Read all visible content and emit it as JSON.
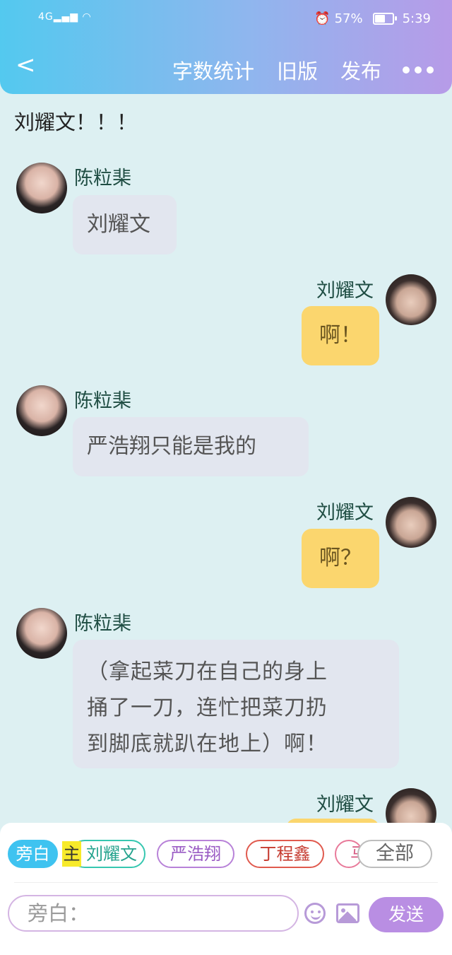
{
  "status_bar": {
    "signal": "4G",
    "battery": "57%",
    "time": "5:39"
  },
  "header": {
    "back": "<",
    "word_count": "字数统计",
    "old_version": "旧版",
    "publish": "发布"
  },
  "note": "刘耀文！！！",
  "messages": [
    {
      "side": "left",
      "name": "陈粒棐",
      "lines": [
        "刘耀文"
      ]
    },
    {
      "side": "right",
      "name": "刘耀文",
      "lines": [
        "啊！"
      ]
    },
    {
      "side": "left",
      "name": "陈粒棐",
      "lines": [
        "严浩翔只能是我的"
      ]
    },
    {
      "side": "right",
      "name": "刘耀文",
      "lines": [
        "啊？"
      ]
    },
    {
      "side": "left",
      "name": "陈粒棐",
      "lines": [
        "（拿起菜刀在自己的身上",
        "捅了一刀，连忙把菜刀扔",
        "到脚底就趴在地上）啊！"
      ]
    },
    {
      "side": "right",
      "name": "刘耀文",
      "lines": []
    }
  ],
  "role_chips": {
    "narrator": "旁白",
    "main_tag": "主",
    "liu_yaowen": "刘耀文",
    "yan_haoxiang": "严浩翔",
    "ding_chengxin": "丁程鑫",
    "truncated": "马",
    "all": "全部"
  },
  "composer": {
    "placeholder": "旁白：",
    "send": "发送"
  }
}
